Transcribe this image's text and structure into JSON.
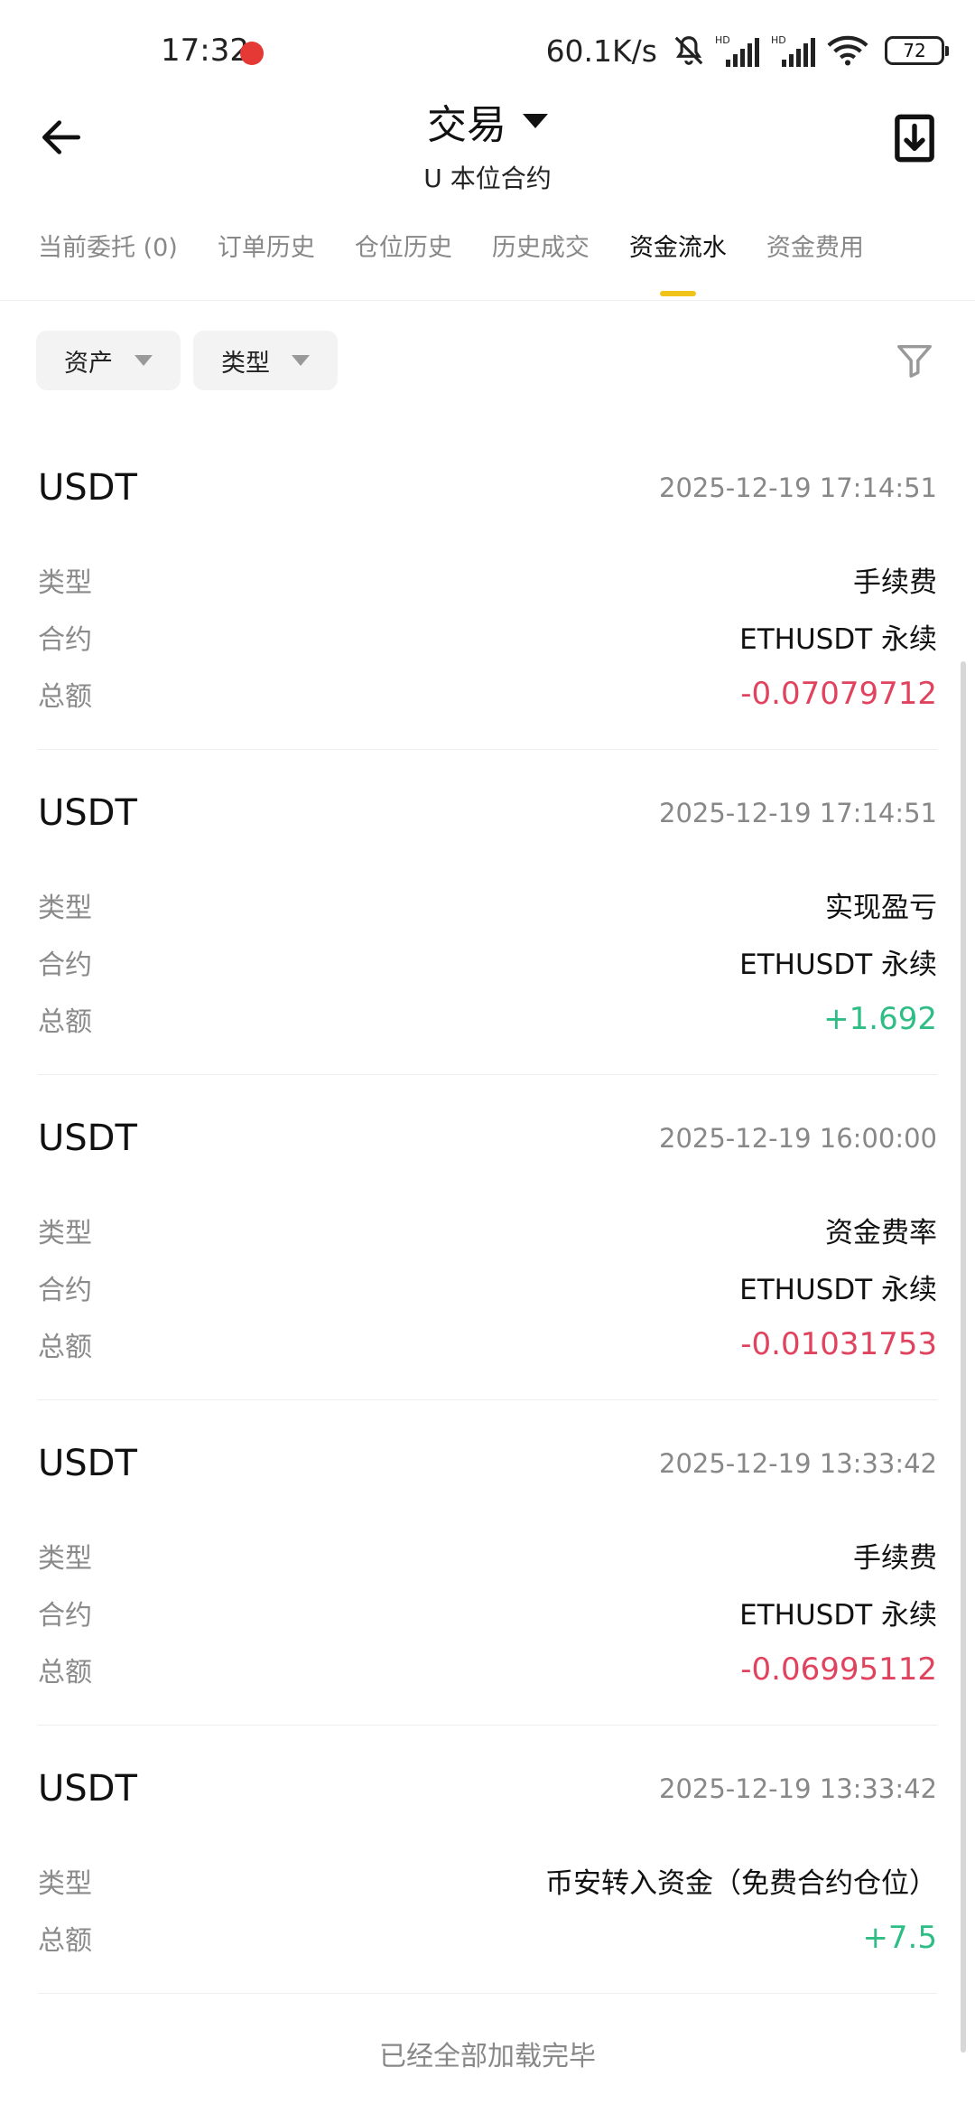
{
  "status_bar": {
    "time": "17:32",
    "net_speed": "60.1K/s",
    "battery": "72",
    "icons": [
      "notification-dot-icon",
      "mute-bell-icon",
      "signal-hd-icon",
      "signal-hd-icon",
      "wifi-icon",
      "battery-icon"
    ]
  },
  "header": {
    "title": "交易",
    "subtitle": "U 本位合约",
    "back_icon": "arrow-left-icon",
    "download_icon": "download-icon"
  },
  "tabs": [
    {
      "label": "当前委托 (0)",
      "active": false
    },
    {
      "label": "订单历史",
      "active": false
    },
    {
      "label": "仓位历史",
      "active": false
    },
    {
      "label": "历史成交",
      "active": false
    },
    {
      "label": "资金流水",
      "active": true
    },
    {
      "label": "资金费用",
      "active": false
    }
  ],
  "filters": {
    "asset_label": "资产",
    "type_label": "类型",
    "filter_icon": "filter-funnel-icon"
  },
  "labels": {
    "type": "类型",
    "contract": "合约",
    "total": "总额"
  },
  "records": [
    {
      "asset": "USDT",
      "time": "2025-12-19 17:14:51",
      "type": "手续费",
      "contract": "ETHUSDT 永续",
      "amount": "-0.07079712",
      "sign": "neg"
    },
    {
      "asset": "USDT",
      "time": "2025-12-19 17:14:51",
      "type": "实现盈亏",
      "contract": "ETHUSDT 永续",
      "amount": "+1.692",
      "sign": "pos"
    },
    {
      "asset": "USDT",
      "time": "2025-12-19 16:00:00",
      "type": "资金费率",
      "contract": "ETHUSDT 永续",
      "amount": "-0.01031753",
      "sign": "neg"
    },
    {
      "asset": "USDT",
      "time": "2025-12-19 13:33:42",
      "type": "手续费",
      "contract": "ETHUSDT 永续",
      "amount": "-0.06995112",
      "sign": "neg"
    },
    {
      "asset": "USDT",
      "time": "2025-12-19 13:33:42",
      "type": "币安转入资金（免费合约仓位）",
      "amount": "+7.5",
      "sign": "pos"
    }
  ],
  "end_note": "已经全部加载完毕",
  "colors": {
    "negative": "#e0435e",
    "positive": "#2ebd85",
    "accent": "#f0c419"
  }
}
